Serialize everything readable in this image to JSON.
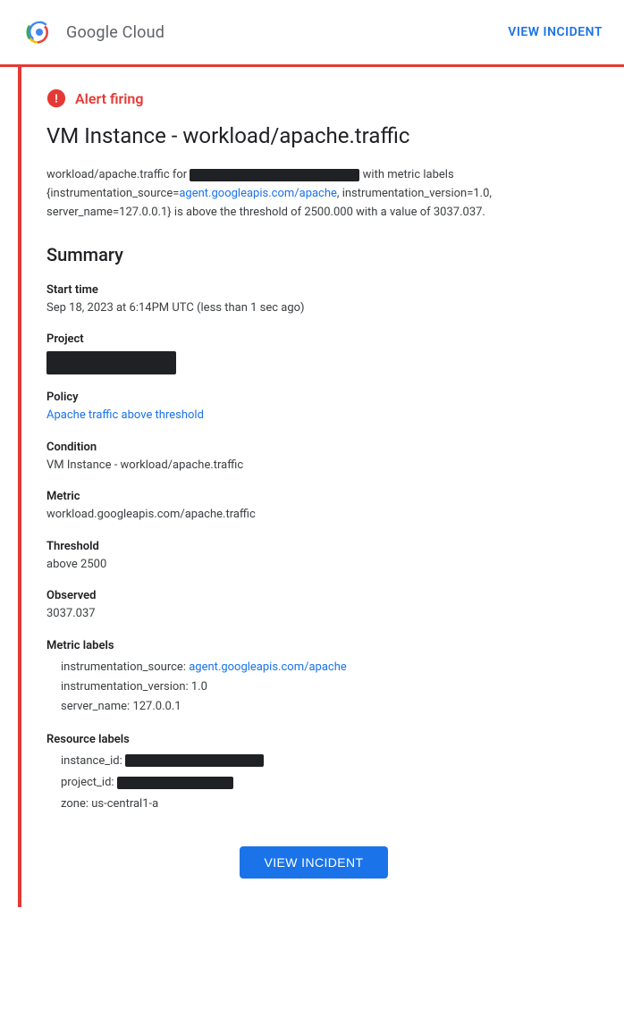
{
  "header": {
    "logo_text": "Google Cloud",
    "view_incident_label": "VIEW INCIDENT"
  },
  "alert": {
    "firing_label": "Alert firing",
    "title": "VM Instance - workload/apache.traffic",
    "description_prefix": "workload/apache.traffic for",
    "description_redacted": true,
    "description_suffix_part1": "with metric labels {instrumentation_source=",
    "description_link_text": "agent.googleapis.com/apache",
    "description_link_href": "agent.googleapis.com/apache",
    "description_suffix_part2": ", instrumentation_version=1.0, server_name=127.0.0.1} is above the threshold of 2500.000 with a value of 3037.037."
  },
  "summary": {
    "heading": "Summary",
    "start_time_label": "Start time",
    "start_time_value": "Sep 18, 2023 at 6:14PM UTC (less than 1 sec ago)",
    "project_label": "Project",
    "policy_label": "Policy",
    "policy_link_text": "Apache traffic above threshold",
    "policy_link_href": "#",
    "condition_label": "Condition",
    "condition_value": "VM Instance - workload/apache.traffic",
    "metric_label": "Metric",
    "metric_value": "workload.googleapis.com/apache.traffic",
    "threshold_label": "Threshold",
    "threshold_value": "above 2500",
    "observed_label": "Observed",
    "observed_value": "3037.037",
    "metric_labels_label": "Metric labels",
    "instrumentation_source_label": "instrumentation_source:",
    "instrumentation_source_link": "agent.googleapis.com/apache",
    "instrumentation_source_href": "agent.googleapis.com/apache",
    "instrumentation_version_label": "instrumentation_version:",
    "instrumentation_version_value": "1.0",
    "server_name_label": "server_name:",
    "server_name_value": "127.0.0.1",
    "resource_labels_label": "Resource labels",
    "instance_id_label": "instance_id:",
    "project_id_label": "project_id:",
    "zone_label": "zone:",
    "zone_value": "us-central1-a"
  },
  "footer": {
    "view_incident_button_label": "VIEW INCIDENT"
  }
}
